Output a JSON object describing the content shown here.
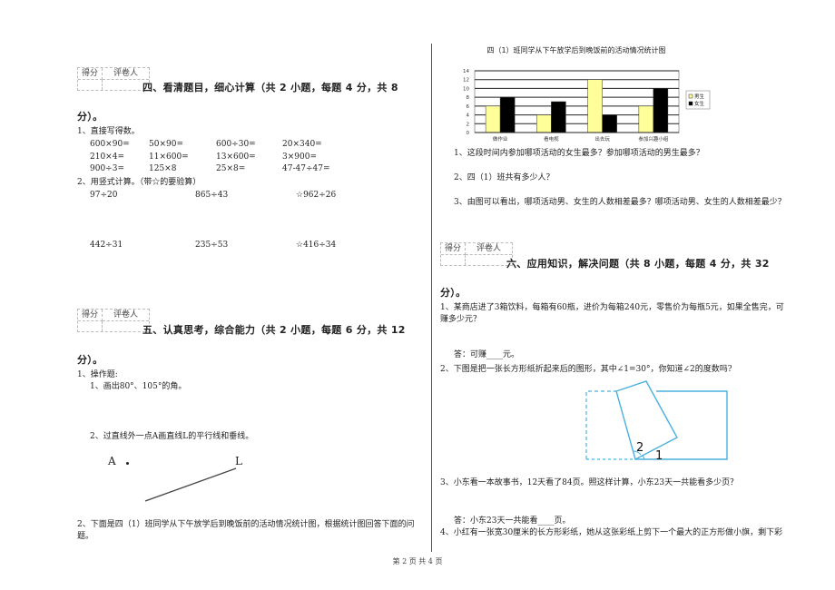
{
  "left": {
    "score_box": {
      "col1": "得分",
      "col2": "评卷人"
    },
    "section4": {
      "title_line1": "四、看清题目，细心计算（共 2 小题，每题 4 分，共 8",
      "title_line2": "分）。",
      "q1_label": "1、直接写得数。",
      "q1_rows": [
        [
          "600×90=",
          "50×90=",
          "600÷30=",
          "20×340="
        ],
        [
          "210×4=",
          "11×600=",
          "13×600=",
          "3×900="
        ],
        [
          "900÷3=",
          "125×8",
          "25×8=",
          "47-47÷47="
        ]
      ],
      "q2_label": "2、用竖式计算。（带☆的要验算）",
      "q2_rows": [
        [
          "97÷20",
          "865÷43",
          "☆962÷26"
        ],
        [
          "442÷31",
          "235÷53",
          "☆416÷34"
        ]
      ]
    },
    "section5": {
      "title_line1": "五、认真思考，综合能力（共 2 小题，每题 6 分，共 12",
      "title_line2": "分）。",
      "q1_label": "1、操作题:",
      "q1_sub1": "1、画出80°、105°的角。",
      "q1_sub2": "2、过直线外一点A画直线L的平行线和垂线。",
      "point_label": "A",
      "line_label": "L",
      "q2_line1": "2、下面是四（1）班同学从下午放学后到晚饭前的活动情况统计图，根据统计图回答下面的问",
      "q2_line2": "题。"
    }
  },
  "right": {
    "chart_questions": [
      "1、这段时间内参加哪项活动的女生最多？参加哪项活动的男生最多？",
      "2、四（1）班共有多少人？",
      "3、由图可以看出，哪项活动男、女生的人数相差最多？哪项活动男、女生的人数相差最少？"
    ],
    "score_box": {
      "col1": "得分",
      "col2": "评卷人"
    },
    "section6": {
      "title_line1": "六、应用知识，解决问题（共 8 小题，每题 4 分，共 32",
      "title_line2": "分）。",
      "q1_line1": "1、某商店进了3箱饮料，每箱有60瓶，进价为每箱240元，零售价为每瓶5元，如果全售完，可",
      "q1_line2": "赚多少元？",
      "q1_answer": "答：可赚____元。",
      "q2_line": "2、下图是把一张长方形纸折起来后的图形，其中∠1=30°，你知道∠2的度数吗?",
      "angle1_label": "1",
      "angle2_label": "2",
      "q3_line": "3、小东看一本故事书，12天看了84页。照这样计算，小东23天一共能看多少页？",
      "q3_answer": "答：小东23天一共能看____页。",
      "q4_line": "4、小红有一张宽30厘米的长方形彩纸，她从这张彩纸上剪下一个最大的正方形做小旗，剩下彩"
    }
  },
  "footer": "第 2 页 共 4 页",
  "chart_data": {
    "type": "bar",
    "title": "四（1）班同学从下午放学后到晚饭前的活动情况统计图",
    "categories": [
      "做作业",
      "看电视",
      "出去玩",
      "参加兴趣小组"
    ],
    "series": [
      {
        "name": "男生",
        "values": [
          6,
          4,
          12,
          6
        ],
        "color": "#ffff99"
      },
      {
        "name": "女生",
        "values": [
          8,
          7,
          4,
          10
        ],
        "color": "#000000"
      }
    ],
    "yticks": [
      "0",
      "2",
      "4",
      "6",
      "8",
      "10",
      "12",
      "14"
    ],
    "ylim": [
      0,
      14
    ],
    "xlabel": "",
    "ylabel": "",
    "grid": true,
    "legend": "right"
  }
}
